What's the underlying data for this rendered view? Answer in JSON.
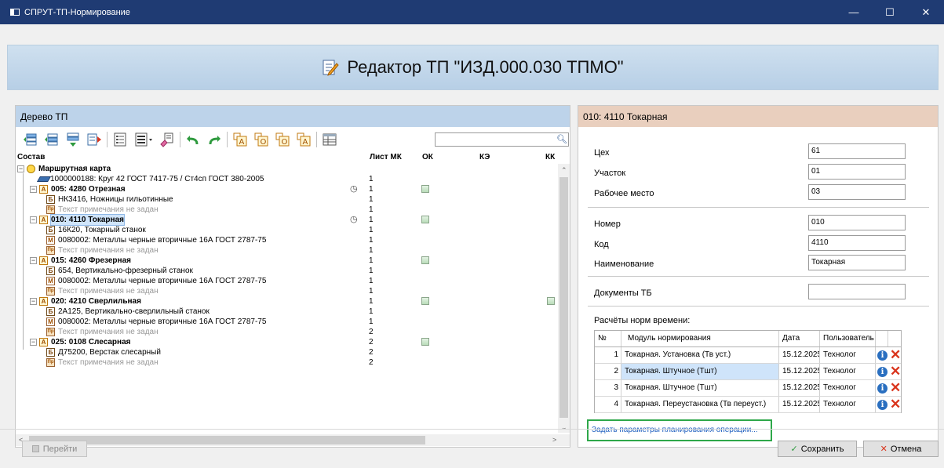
{
  "window": {
    "title": "СПРУТ-ТП-Нормирование",
    "minimize": "—",
    "maximize": "☐",
    "close": "✕"
  },
  "header": {
    "title": "Редактор ТП \"ИЗД.000.030 ТПМО\""
  },
  "tree_panel": {
    "title": "Дерево ТП",
    "search_value": "",
    "columns": {
      "composition": "Состав",
      "sheet": "Лист МК",
      "ok": "ОК",
      "ke": "КЭ",
      "kk": "КК"
    },
    "rows": [
      {
        "level": 0,
        "icon": "route-map-icon",
        "label": "Маршрутная карта",
        "bold": true,
        "sheet": "",
        "clock": false,
        "ok": false,
        "kk": false
      },
      {
        "level": 1,
        "icon": "blank-icon",
        "label": "1000000188: Круг 42 ГОСТ 7417-75 / Ст4сп ГОСТ 380-2005",
        "bold": false,
        "sheet": "1",
        "clock": false,
        "ok": false,
        "kk": false
      },
      {
        "level": 1,
        "icon": "operation-icon",
        "letter": "А",
        "label": "005: 4280 Отрезная",
        "bold": true,
        "sheet": "1",
        "clock": true,
        "ok": true,
        "kk": false
      },
      {
        "level": 2,
        "icon": "equipment-icon",
        "letter": "Б",
        "label": "НК3416, Ножницы гильотинные",
        "bold": false,
        "sheet": "1",
        "clock": false,
        "ok": false,
        "kk": false
      },
      {
        "level": 2,
        "icon": "note-icon",
        "letter": "Пр",
        "label": "Текст примечания не задан",
        "gray": true,
        "sheet": "1",
        "clock": false,
        "ok": false,
        "kk": false
      },
      {
        "level": 1,
        "icon": "operation-icon",
        "letter": "А",
        "label": "010: 4110 Токарная",
        "bold": true,
        "selected": true,
        "sheet": "1",
        "clock": true,
        "ok": true,
        "kk": false
      },
      {
        "level": 2,
        "icon": "equipment-icon",
        "letter": "Б",
        "label": "16К20, Токарный станок",
        "bold": false,
        "sheet": "1",
        "clock": false,
        "ok": false,
        "kk": false
      },
      {
        "level": 2,
        "icon": "material-icon",
        "letter": "М",
        "label": "0080002: Металлы черные вторичные 16А ГОСТ 2787-75",
        "bold": false,
        "sheet": "1",
        "clock": false,
        "ok": false,
        "kk": false
      },
      {
        "level": 2,
        "icon": "note-icon",
        "letter": "Пр",
        "label": "Текст примечания не задан",
        "gray": true,
        "sheet": "1",
        "clock": false,
        "ok": false,
        "kk": false
      },
      {
        "level": 1,
        "icon": "operation-icon",
        "letter": "А",
        "label": "015: 4260 Фрезерная",
        "bold": true,
        "sheet": "1",
        "clock": false,
        "ok": true,
        "kk": false
      },
      {
        "level": 2,
        "icon": "equipment-icon",
        "letter": "Б",
        "label": "654, Вертикально-фрезерный станок",
        "bold": false,
        "sheet": "1",
        "clock": false,
        "ok": false,
        "kk": false
      },
      {
        "level": 2,
        "icon": "material-icon",
        "letter": "М",
        "label": "0080002: Металлы черные вторичные 16А ГОСТ 2787-75",
        "bold": false,
        "sheet": "1",
        "clock": false,
        "ok": false,
        "kk": false
      },
      {
        "level": 2,
        "icon": "note-icon",
        "letter": "Пр",
        "label": "Текст примечания не задан",
        "gray": true,
        "sheet": "1",
        "clock": false,
        "ok": false,
        "kk": false
      },
      {
        "level": 1,
        "icon": "operation-icon",
        "letter": "А",
        "label": "020: 4210 Сверлильная",
        "bold": true,
        "sheet": "1",
        "clock": false,
        "ok": true,
        "kk": true
      },
      {
        "level": 2,
        "icon": "equipment-icon",
        "letter": "Б",
        "label": "2А125, Вертикально-сверлильный станок",
        "bold": false,
        "sheet": "1",
        "clock": false,
        "ok": false,
        "kk": false
      },
      {
        "level": 2,
        "icon": "material-icon",
        "letter": "М",
        "label": "0080002: Металлы черные вторичные 16А ГОСТ 2787-75",
        "bold": false,
        "sheet": "1",
        "clock": false,
        "ok": false,
        "kk": false
      },
      {
        "level": 2,
        "icon": "note-icon",
        "letter": "Пр",
        "label": "Текст примечания не задан",
        "gray": true,
        "sheet": "2",
        "clock": false,
        "ok": false,
        "kk": false
      },
      {
        "level": 1,
        "icon": "operation-icon",
        "letter": "А",
        "label": "025: 0108 Слесарная",
        "bold": true,
        "sheet": "2",
        "clock": false,
        "ok": true,
        "kk": false
      },
      {
        "level": 2,
        "icon": "equipment-icon",
        "letter": "Б",
        "label": "Д75200, Верстак слесарный",
        "bold": false,
        "sheet": "2",
        "clock": false,
        "ok": false,
        "kk": false
      },
      {
        "level": 2,
        "icon": "note-icon",
        "letter": "Пр",
        "label": "Текст примечания не задан",
        "gray": true,
        "sheet": "2",
        "clock": false,
        "ok": false,
        "kk": false
      }
    ]
  },
  "details_panel": {
    "title": "010: 4110 Токарная",
    "fields": {
      "workshop": {
        "label": "Цех",
        "value": "61"
      },
      "section": {
        "label": "Участок",
        "value": "01"
      },
      "workplace": {
        "label": "Рабочее место",
        "value": "03"
      },
      "number": {
        "label": "Номер",
        "value": "010"
      },
      "code": {
        "label": "Код",
        "value": "4110"
      },
      "name": {
        "label": "Наименование",
        "value": "Токарная"
      },
      "docs": {
        "label": "Документы ТБ",
        "value": ""
      }
    },
    "norms_title": "Расчёты норм времени:",
    "norms_columns": {
      "num": "№",
      "module": "Модуль нормирования",
      "date": "Дата",
      "user": "Пользователь"
    },
    "norms_rows": [
      {
        "num": "1",
        "module": "Токарная. Установка (Тв уст.)",
        "date": "15.12.2025",
        "user": "Технолог"
      },
      {
        "num": "2",
        "module": "Токарная. Штучное (Тшт)",
        "date": "15.12.2025",
        "user": "Технолог",
        "selected": true
      },
      {
        "num": "3",
        "module": "Токарная. Штучное (Тшт)",
        "date": "15.12.2025",
        "user": "Технолог"
      },
      {
        "num": "4",
        "module": "Токарная. Переустановка (Тв переуст.)",
        "date": "15.12.2025",
        "user": "Технолог"
      }
    ],
    "plan_link": "Задать параметры планирования операции..."
  },
  "buttons": {
    "go": "Перейти",
    "save": "Сохранить",
    "cancel": "Отмена"
  },
  "colors": {
    "titlebar": "#1f3b73",
    "tree_header": "#bdd3ea",
    "details_header": "#e9cfbe",
    "link": "#1f5fbf",
    "highlight_border": "#2ea84a",
    "delete": "#d9341c",
    "info": "#2a6fc0"
  }
}
